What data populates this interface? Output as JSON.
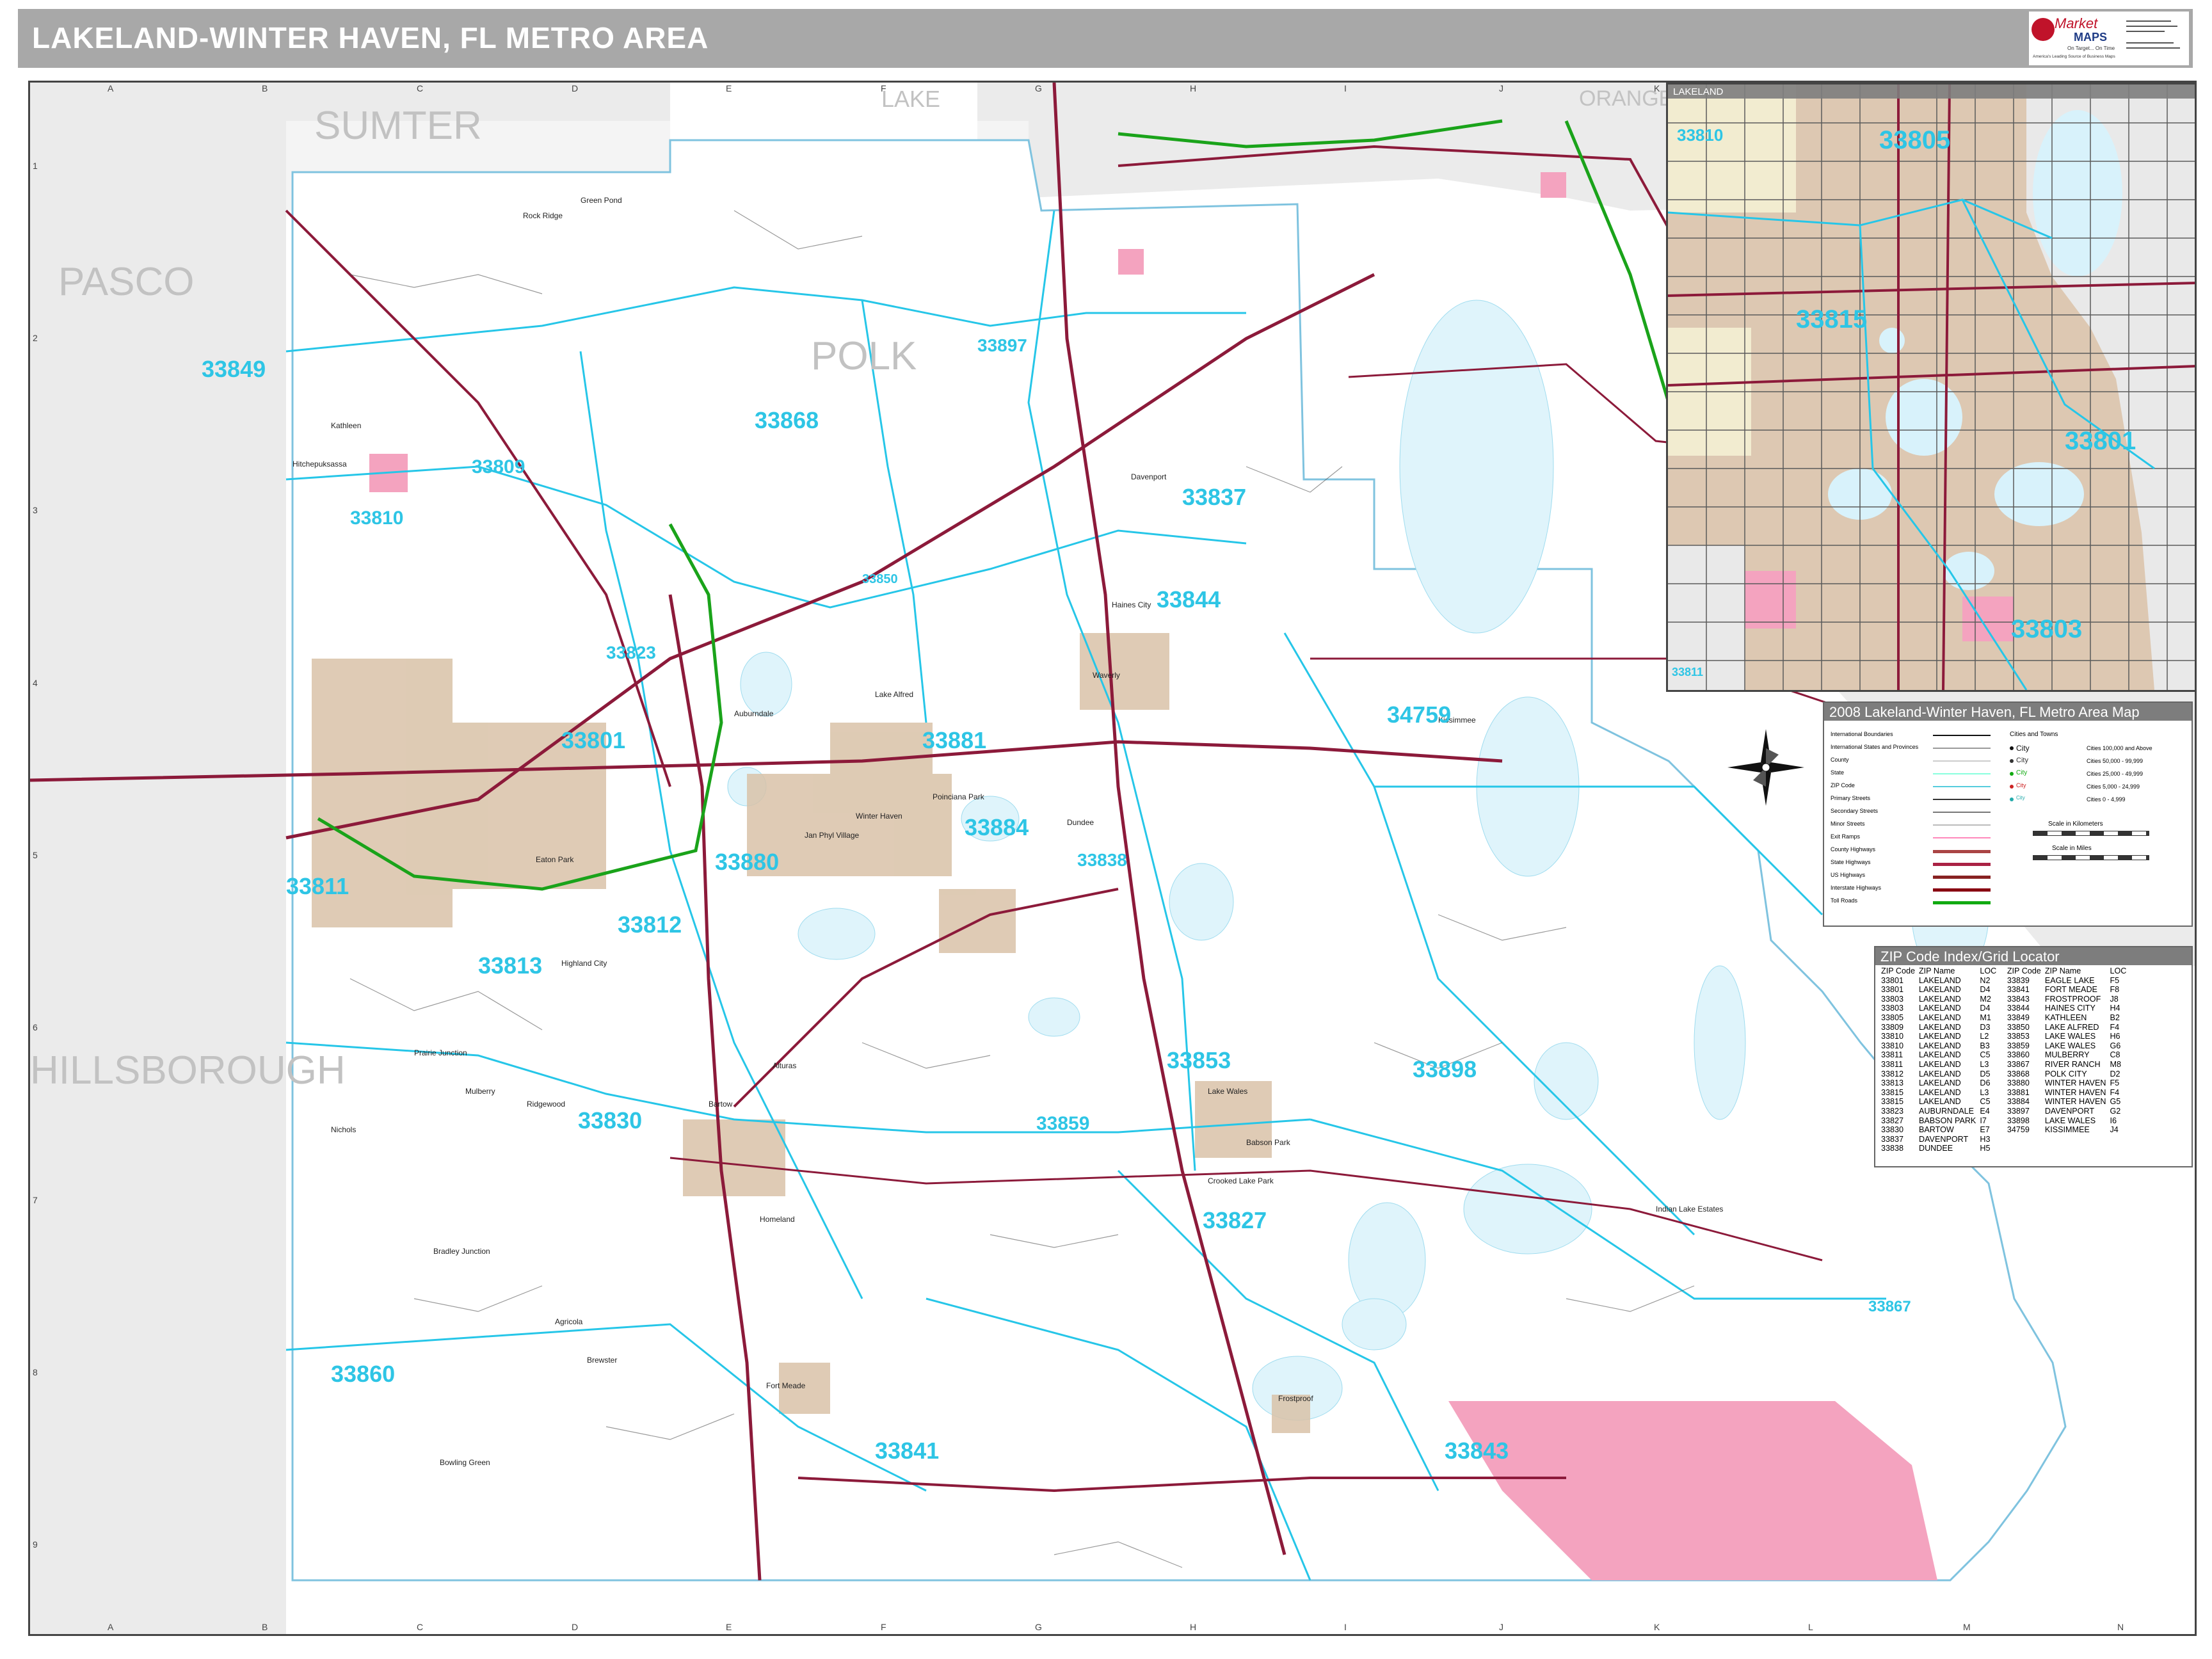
{
  "title": "LAKELAND-WINTER HAVEN, FL METRO AREA",
  "logo": {
    "word1": "Market",
    "word2": "MAPS",
    "tagline1": "On Target... On Time",
    "tagline2": "America's Leading Source of Business Maps"
  },
  "grid": {
    "columns": [
      "A",
      "B",
      "C",
      "D",
      "E",
      "F",
      "G",
      "H",
      "I",
      "J",
      "K",
      "L",
      "M",
      "N"
    ],
    "rows": [
      "1",
      "2",
      "3",
      "4",
      "5",
      "6",
      "7",
      "8",
      "9"
    ]
  },
  "counties": [
    "SUMTER",
    "LAKE",
    "ORANGE",
    "PASCO",
    "POLK",
    "HILLSBOROUGH"
  ],
  "zip_labels": [
    "33849",
    "33868",
    "33897",
    "33809",
    "33810",
    "33837",
    "33823",
    "33850",
    "33844",
    "33801",
    "33881",
    "34759",
    "33880",
    "33884",
    "33838",
    "33811",
    "33812",
    "33813",
    "33853",
    "33898",
    "33830",
    "33859",
    "33827",
    "33867",
    "33860",
    "33841",
    "33843",
    "33805",
    "33815",
    "33803"
  ],
  "inset": {
    "title": "LAKELAND",
    "zips": [
      "33810",
      "33805",
      "33815",
      "33801",
      "33803",
      "33811"
    ]
  },
  "legend": {
    "title": "2008 Lakeland-Winter Haven, FL Metro Area Map",
    "left_items": [
      "International Boundaries",
      "International States and Provinces",
      "County",
      "State",
      "ZIP Code",
      "Primary Streets",
      "Secondary Streets",
      "Minor Streets",
      "Exit Ramps",
      "County Highways",
      "State Highways",
      "US Highways",
      "Interstate Highways",
      "Toll Roads"
    ],
    "right_header": "Cities and Towns",
    "city_items": [
      {
        "name": "City",
        "desc": "Cities 100,000 and Above"
      },
      {
        "name": "City",
        "desc": "Cities 50,000 - 99,999"
      },
      {
        "name": "City",
        "desc": "Cities 25,000 - 49,999"
      },
      {
        "name": "City",
        "desc": "Cities 5,000 - 24,999"
      },
      {
        "name": "City",
        "desc": "Cities 0 - 4,999"
      }
    ],
    "scale_km": "Scale in Kilometers",
    "scale_miles": "Scale in Miles"
  },
  "zip_index": {
    "title": "ZIP Code Index/Grid Locator",
    "headers": [
      "ZIP Code",
      "ZIP Name",
      "LOC",
      "ZIP Code",
      "ZIP Name",
      "LOC"
    ],
    "rows": [
      [
        "33801",
        "LAKELAND",
        "N2",
        "33839",
        "EAGLE LAKE",
        "F5"
      ],
      [
        "33801",
        "LAKELAND",
        "D4",
        "33841",
        "FORT MEADE",
        "F8"
      ],
      [
        "33803",
        "LAKELAND",
        "M2",
        "33843",
        "FROSTPROOF",
        "J8"
      ],
      [
        "33803",
        "LAKELAND",
        "D4",
        "33844",
        "HAINES CITY",
        "H4"
      ],
      [
        "33805",
        "LAKELAND",
        "M1",
        "33849",
        "KATHLEEN",
        "B2"
      ],
      [
        "33809",
        "LAKELAND",
        "D3",
        "33850",
        "LAKE ALFRED",
        "F4"
      ],
      [
        "33810",
        "LAKELAND",
        "L2",
        "33853",
        "LAKE WALES",
        "H6"
      ],
      [
        "33810",
        "LAKELAND",
        "B3",
        "33859",
        "LAKE WALES",
        "G6"
      ],
      [
        "33811",
        "LAKELAND",
        "C5",
        "33860",
        "MULBERRY",
        "C8"
      ],
      [
        "33811",
        "LAKELAND",
        "L3",
        "33867",
        "RIVER RANCH",
        "M8"
      ],
      [
        "33812",
        "LAKELAND",
        "D5",
        "33868",
        "POLK CITY",
        "D2"
      ],
      [
        "33813",
        "LAKELAND",
        "D6",
        "33880",
        "WINTER HAVEN",
        "F5"
      ],
      [
        "33815",
        "LAKELAND",
        "L3",
        "33881",
        "WINTER HAVEN",
        "F4"
      ],
      [
        "33815",
        "LAKELAND",
        "C5",
        "33884",
        "WINTER HAVEN",
        "G5"
      ],
      [
        "33823",
        "AUBURNDALE",
        "E4",
        "33897",
        "DAVENPORT",
        "G2"
      ],
      [
        "33827",
        "BABSON PARK",
        "I7",
        "33898",
        "LAKE WALES",
        "I6"
      ],
      [
        "33830",
        "BARTOW",
        "E7",
        "34759",
        "KISSIMMEE",
        "J4"
      ],
      [
        "33837",
        "DAVENPORT",
        "H3",
        "",
        "",
        ""
      ],
      [
        "33838",
        "DUNDEE",
        "H5",
        "",
        "",
        ""
      ]
    ]
  },
  "places": [
    "Rock Ridge",
    "Green Pond",
    "Hitchepuksassa",
    "Winter Haven",
    "Jan Phyl Village",
    "Poinciana Park",
    "Eaton Park",
    "Prairie Junction",
    "Mulberry",
    "Ridgewood",
    "Bradley Junction",
    "Agricola",
    "Fort Meade",
    "Homeland",
    "Lake Wales",
    "Crooked Lake Park",
    "Indian Lake Estates",
    "Frostproof",
    "Babson Park",
    "Highland City",
    "Lake Alfred",
    "Haines City",
    "Davenport",
    "Auburndale",
    "Bartow",
    "Dundee",
    "Waverly",
    "Alturas",
    "Kathleen",
    "Nichols",
    "Brewster",
    "Bowling Green",
    "Kissimmee"
  ],
  "colors": {
    "water": "#dff4fb",
    "zip_line": "#26c6e8",
    "county_line": "#7fc3df",
    "toll": "#1aa31a",
    "highway": "#8c1a3a",
    "city_tan": "#d9c2a8",
    "city_pink": "#f4a3bf",
    "zip_text": "#2ec5e5",
    "gray_area": "#e8e8e8"
  }
}
